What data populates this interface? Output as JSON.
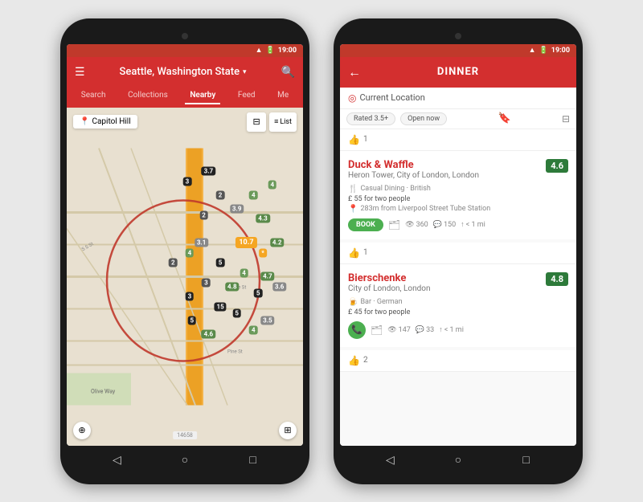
{
  "left_phone": {
    "status_bar": {
      "signal": "▲",
      "battery": "🔋",
      "time": "19:00"
    },
    "header": {
      "menu_icon": "☰",
      "title": "Seattle, Washington State",
      "chevron": "▾",
      "search_icon": "🔍"
    },
    "tabs": [
      {
        "label": "Search",
        "active": false
      },
      {
        "label": "Collections",
        "active": false
      },
      {
        "label": "Nearby",
        "active": true
      },
      {
        "label": "Feed",
        "active": false
      },
      {
        "label": "Me",
        "active": false
      }
    ],
    "map": {
      "location": "Capitol Hill",
      "location_icon": "◎",
      "filter_icon": "⊞",
      "list_label": "List"
    },
    "nav_buttons": [
      "◁",
      "○",
      "□"
    ]
  },
  "right_phone": {
    "status_bar": {
      "signal": "▲",
      "battery": "🔋",
      "time": "19:00"
    },
    "header": {
      "back_icon": "←",
      "title": "DINNER"
    },
    "location": {
      "pin_icon": "◎",
      "text": "Current Location"
    },
    "filters": [
      {
        "label": "Rated 3.5+"
      },
      {
        "label": "Open now"
      }
    ],
    "restaurants": [
      {
        "liked": false,
        "like_count": "",
        "like_divider_count": "1",
        "name": "Duck & Waffle",
        "location": "Heron Tower, City of London, London",
        "cuisine": "🍴 Casual Dining · British",
        "price": "£ 55 for two people",
        "distance": "283m from Liverpool Street Tube Station",
        "rating": "4.6",
        "rating_color": "#2d7a3a",
        "has_book": true,
        "book_label": "BOOK",
        "stats": [
          {
            "icon": "👁",
            "value": "360"
          },
          {
            "icon": "💬",
            "value": "150"
          },
          {
            "icon": "↑",
            "value": "< 1 mi"
          }
        ]
      },
      {
        "liked": true,
        "like_divider_count": "1",
        "name": "Bierschenke",
        "location": "City of London, London",
        "cuisine": "🍺 Bar · German",
        "price": "£ 45 for two people",
        "distance": "",
        "rating": "4.8",
        "rating_color": "#2d7a3a",
        "has_book": false,
        "stats": [
          {
            "icon": "👁",
            "value": "147"
          },
          {
            "icon": "💬",
            "value": "33"
          },
          {
            "icon": "↑",
            "value": "< 1 mi"
          }
        ]
      }
    ],
    "bottom_divider": {
      "like_count": "2"
    },
    "nav_buttons": [
      "◁",
      "○",
      "□"
    ]
  },
  "map_markers": [
    {
      "x": 55,
      "y": 28,
      "value": "3",
      "color": "#222"
    },
    {
      "x": 63,
      "y": 26,
      "value": "3.7",
      "color": "#222"
    },
    {
      "x": 72,
      "y": 24,
      "value": "2",
      "color": "#555"
    },
    {
      "x": 62,
      "y": 34,
      "value": "2",
      "color": "#555"
    },
    {
      "x": 75,
      "y": 35,
      "value": "3.9",
      "color": "#8a9"
    },
    {
      "x": 82,
      "y": 32,
      "value": "4",
      "color": "#6a9"
    },
    {
      "x": 85,
      "y": 38,
      "value": "4.3",
      "color": "#5a8"
    },
    {
      "x": 90,
      "y": 28,
      "value": "4",
      "color": "#6a9"
    },
    {
      "x": 80,
      "y": 43,
      "value": "10.7",
      "color": "#f90"
    },
    {
      "x": 87,
      "y": 47,
      "value": "*",
      "color": "#f90"
    },
    {
      "x": 92,
      "y": 44,
      "value": "4.2",
      "color": "#5a8"
    },
    {
      "x": 78,
      "y": 52,
      "value": "4",
      "color": "#6a9"
    },
    {
      "x": 84,
      "y": 57,
      "value": "5",
      "color": "#222"
    },
    {
      "x": 88,
      "y": 52,
      "value": "4.7",
      "color": "#5a8"
    },
    {
      "x": 93,
      "y": 55,
      "value": "3.6",
      "color": "#8a9"
    },
    {
      "x": 48,
      "y": 48,
      "value": "2",
      "color": "#555"
    },
    {
      "x": 55,
      "y": 58,
      "value": "3",
      "color": "#222"
    },
    {
      "x": 62,
      "y": 55,
      "value": "3",
      "color": "#555"
    },
    {
      "x": 68,
      "y": 60,
      "value": "15",
      "color": "#222"
    },
    {
      "x": 75,
      "y": 62,
      "value": "5",
      "color": "#222"
    },
    {
      "x": 82,
      "y": 67,
      "value": "4",
      "color": "#6a9"
    },
    {
      "x": 88,
      "y": 65,
      "value": "3.5",
      "color": "#8a9"
    },
    {
      "x": 57,
      "y": 65,
      "value": "5",
      "color": "#222"
    },
    {
      "x": 63,
      "y": 68,
      "value": "4.6",
      "color": "#5a8"
    },
    {
      "x": 55,
      "y": 45,
      "value": "4",
      "color": "#6a9"
    },
    {
      "x": 60,
      "y": 42,
      "value": "3.1",
      "color": "#8a9"
    },
    {
      "x": 68,
      "y": 48,
      "value": "5",
      "color": "#222"
    },
    {
      "x": 72,
      "y": 55,
      "value": "4.8",
      "color": "#5a8"
    }
  ]
}
